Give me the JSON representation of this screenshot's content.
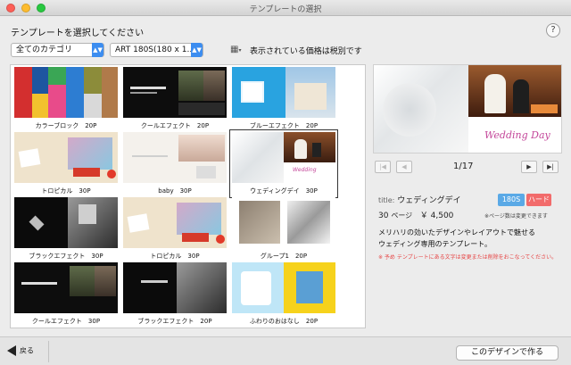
{
  "window": {
    "title": "テンプレートの選択"
  },
  "prompt": "テンプレートを選択してください",
  "help_label": "?",
  "filters": {
    "category": {
      "value": "全てのカテゴリ"
    },
    "product": {
      "value": "ART 180S(180 x 1..."
    },
    "tax_note": "表示されている価格は税別です"
  },
  "templates": [
    {
      "name": "カラーブロック",
      "pages": "20P"
    },
    {
      "name": "クールエフェクト",
      "pages": "20P"
    },
    {
      "name": "ブルーエフェクト",
      "pages": "20P"
    },
    {
      "name": "トロピカル",
      "pages": "30P"
    },
    {
      "name": "baby",
      "pages": "30P"
    },
    {
      "name": "ウェディングデイ",
      "pages": "30P",
      "selected": true
    },
    {
      "name": "ブラックエフェクト",
      "pages": "30P"
    },
    {
      "name": "トロピカル",
      "pages": "30P"
    },
    {
      "name": "グループ1",
      "pages": "20P"
    },
    {
      "name": "クールエフェクト",
      "pages": "30P"
    },
    {
      "name": "ブラックエフェクト",
      "pages": "20P"
    },
    {
      "name": "ふわりのおはなし",
      "pages": "20P"
    }
  ],
  "preview": {
    "page_indicator": "1/17",
    "script_text": "Wedding Day"
  },
  "detail": {
    "title_label": "title:",
    "title": "ウェディングデイ",
    "size_badge": "180S",
    "cover_badge": "ハード",
    "pages": "30",
    "pages_label": "ページ",
    "price": "￥ 4,500",
    "page_note": "※ページ数は変更できます",
    "desc_line1": "メリハリの効いたデザインやレイアウトで魅せる",
    "desc_line2": "ウェディング専用のテンプレート。",
    "warning": "※ 予め テンプレートにある文字は変更または削除をおこなってください。"
  },
  "footer": {
    "back_label": "戻る",
    "create_label": "このデザインで作る"
  },
  "colors": {
    "accent": "#3c8df0",
    "badge_size": "#5aa9e6",
    "badge_cover": "#f26b6b",
    "warning": "#e64545"
  }
}
